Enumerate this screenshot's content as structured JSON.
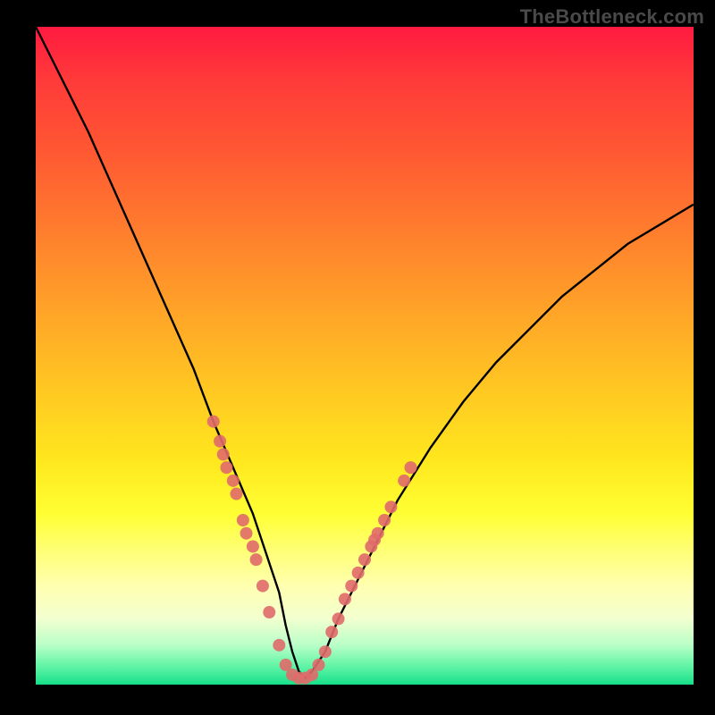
{
  "watermark": "TheBottleneck.com",
  "colors": {
    "background": "#000000",
    "curve": "#000000",
    "marker": "#e06a6a",
    "gradient_top": "#ff1a40",
    "gradient_bottom": "#17e08a"
  },
  "chart_data": {
    "type": "line",
    "title": "",
    "xlabel": "",
    "ylabel": "",
    "xlim": [
      0,
      100
    ],
    "ylim": [
      0,
      100
    ],
    "grid": false,
    "legend": false,
    "series": [
      {
        "name": "bottleneck-curve",
        "x": [
          0,
          4,
          8,
          12,
          16,
          20,
          24,
          27,
          30,
          33,
          35,
          37,
          38,
          39,
          40,
          41,
          42,
          44,
          46,
          49,
          52,
          55,
          60,
          65,
          70,
          75,
          80,
          85,
          90,
          95,
          100
        ],
        "y": [
          100,
          92,
          84,
          75,
          66,
          57,
          48,
          40,
          33,
          26,
          20,
          14,
          9,
          5,
          2,
          1,
          2,
          5,
          10,
          16,
          22,
          28,
          36,
          43,
          49,
          54,
          59,
          63,
          67,
          70,
          73
        ]
      }
    ],
    "markers": {
      "name": "data-points",
      "points": [
        {
          "x": 27,
          "y": 40
        },
        {
          "x": 28,
          "y": 37
        },
        {
          "x": 28.5,
          "y": 35
        },
        {
          "x": 29,
          "y": 33
        },
        {
          "x": 30,
          "y": 31
        },
        {
          "x": 30.5,
          "y": 29
        },
        {
          "x": 31.5,
          "y": 25
        },
        {
          "x": 32,
          "y": 23
        },
        {
          "x": 33,
          "y": 21
        },
        {
          "x": 33.5,
          "y": 19
        },
        {
          "x": 34.5,
          "y": 15
        },
        {
          "x": 35.5,
          "y": 11
        },
        {
          "x": 37,
          "y": 6
        },
        {
          "x": 38,
          "y": 3
        },
        {
          "x": 39,
          "y": 1.5
        },
        {
          "x": 40,
          "y": 1
        },
        {
          "x": 41,
          "y": 1
        },
        {
          "x": 42,
          "y": 1.5
        },
        {
          "x": 43,
          "y": 3
        },
        {
          "x": 44,
          "y": 5
        },
        {
          "x": 45,
          "y": 8
        },
        {
          "x": 46,
          "y": 10
        },
        {
          "x": 47,
          "y": 13
        },
        {
          "x": 48,
          "y": 15
        },
        {
          "x": 49,
          "y": 17
        },
        {
          "x": 50,
          "y": 19
        },
        {
          "x": 51,
          "y": 21
        },
        {
          "x": 51.5,
          "y": 22
        },
        {
          "x": 52,
          "y": 23
        },
        {
          "x": 53,
          "y": 25
        },
        {
          "x": 54,
          "y": 27
        },
        {
          "x": 56,
          "y": 31
        },
        {
          "x": 57,
          "y": 33
        }
      ]
    }
  }
}
